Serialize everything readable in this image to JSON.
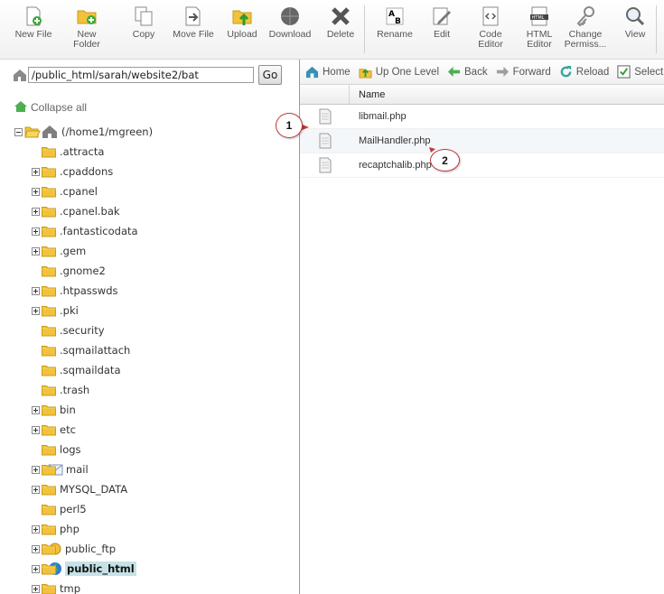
{
  "toolbar": {
    "buttons": [
      {
        "label": "New File",
        "icon": "new-file-icon"
      },
      {
        "label": "New Folder",
        "icon": "new-folder-icon"
      },
      {
        "label": "Copy",
        "icon": "copy-icon"
      },
      {
        "label": "Move File",
        "icon": "move-file-icon"
      },
      {
        "label": "Upload",
        "icon": "upload-icon"
      },
      {
        "label": "Download",
        "icon": "download-icon"
      },
      {
        "label": "Delete",
        "icon": "delete-icon"
      },
      {
        "label": "Rename",
        "icon": "rename-icon"
      },
      {
        "label": "Edit",
        "icon": "edit-icon"
      },
      {
        "label": "Code Editor",
        "icon": "code-editor-icon"
      },
      {
        "label": "HTML Editor",
        "icon": "html-editor-icon"
      },
      {
        "label": "Change Permiss...",
        "icon": "permissions-icon"
      },
      {
        "label": "View",
        "icon": "view-icon"
      }
    ]
  },
  "left": {
    "path_value": "/public_html/sarah/website2/bat",
    "go_label": "Go",
    "collapse_all": "Collapse all",
    "root_label": "(/home1/mgreen)",
    "tree": [
      {
        "label": ".attracta",
        "expandable": false
      },
      {
        "label": ".cpaddons",
        "expandable": true
      },
      {
        "label": ".cpanel",
        "expandable": true
      },
      {
        "label": ".cpanel.bak",
        "expandable": true
      },
      {
        "label": ".fantasticodata",
        "expandable": true
      },
      {
        "label": ".gem",
        "expandable": true
      },
      {
        "label": ".gnome2",
        "expandable": false
      },
      {
        "label": ".htpasswds",
        "expandable": true
      },
      {
        "label": ".pki",
        "expandable": true
      },
      {
        "label": ".security",
        "expandable": false
      },
      {
        "label": ".sqmailattach",
        "expandable": false
      },
      {
        "label": ".sqmaildata",
        "expandable": false
      },
      {
        "label": ".trash",
        "expandable": false
      },
      {
        "label": "bin",
        "expandable": true
      },
      {
        "label": "etc",
        "expandable": true
      },
      {
        "label": "logs",
        "expandable": false
      },
      {
        "label": "mail",
        "expandable": true
      },
      {
        "label": "MYSQL_DATA",
        "expandable": true
      },
      {
        "label": "perl5",
        "expandable": false
      },
      {
        "label": "php",
        "expandable": true
      },
      {
        "label": "public_ftp",
        "expandable": true
      },
      {
        "label": "public_html",
        "expandable": true
      },
      {
        "label": "tmp",
        "expandable": true
      }
    ]
  },
  "right": {
    "nav": [
      {
        "label": "Home",
        "icon": "home-icon"
      },
      {
        "label": "Up One Level",
        "icon": "up-level-icon"
      },
      {
        "label": "Back",
        "icon": "back-arrow-icon"
      },
      {
        "label": "Forward",
        "icon": "forward-arrow-icon"
      },
      {
        "label": "Reload",
        "icon": "reload-icon"
      },
      {
        "label": "Select",
        "icon": "select-checkbox-icon"
      }
    ],
    "column_name": "Name",
    "files": [
      {
        "name": "libmail.php"
      },
      {
        "name": "MailHandler.php"
      },
      {
        "name": "recaptchalib.php"
      }
    ]
  },
  "annotations": [
    {
      "label": "1"
    },
    {
      "label": "2"
    }
  ],
  "colors": {
    "selected_bg": "#c6e2e6",
    "callout_border": "#c23a3a",
    "folder": "#f2c23c"
  }
}
